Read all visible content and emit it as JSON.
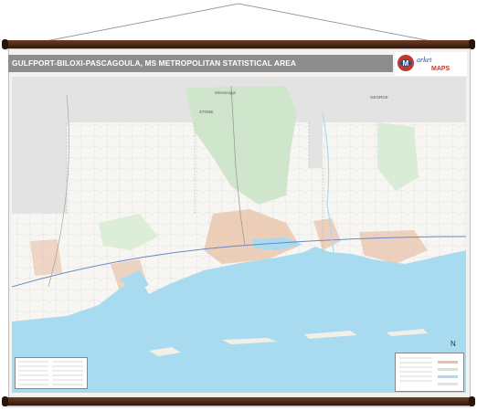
{
  "map": {
    "title": "GULFPORT-BILOXI-PASCAGOULA, MS METROPOLITAN STATISTICAL AREA",
    "state_label": "Mississippi",
    "county_label_east": "GEORGE",
    "county_label_west": "STONE",
    "colors": {
      "water": "#a9dbf0",
      "urban": "#e8c0a6",
      "forest": "#cfe6cc",
      "land": "#f7f6f2",
      "outside": "#e3e3e3",
      "title_bar": "#8d8d8d",
      "rail": "#4a2615"
    }
  },
  "logo": {
    "brand_top": "arket",
    "brand_bottom": "MAPS",
    "letter": "M"
  },
  "compass": {
    "symbol": "N"
  }
}
